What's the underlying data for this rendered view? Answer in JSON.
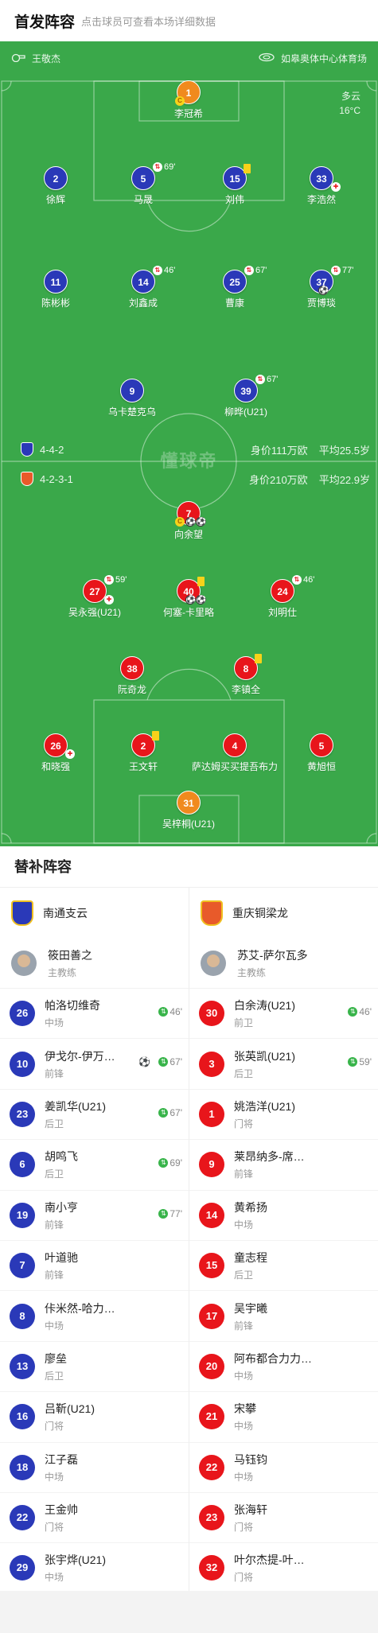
{
  "header": {
    "title": "首发阵容",
    "subtitle": "点击球员可查看本场详细数据"
  },
  "pitch": {
    "referee": "王敬杰",
    "stadium": "如皋奥体中心体育场",
    "weather": "多云",
    "temperature": "16°C",
    "watermark": "懂球帝",
    "home": {
      "formation": "4-4-2",
      "value": "身价111万欧",
      "avg_age": "平均25.5岁",
      "color": "#2a39b8"
    },
    "away": {
      "formation": "4-2-3-1",
      "value": "身价210万欧",
      "avg_age": "平均22.9岁",
      "color": "#e8151b"
    },
    "home_players": [
      {
        "num": "1",
        "name": "李冠希",
        "gk": true,
        "captain": true
      },
      {
        "num": "2",
        "name": "徐辉"
      },
      {
        "num": "5",
        "name": "马晟",
        "sub": "69'"
      },
      {
        "num": "15",
        "name": "刘伟",
        "yellow": true
      },
      {
        "num": "33",
        "name": "李浩然",
        "kick": true
      },
      {
        "num": "11",
        "name": "陈彬彬"
      },
      {
        "num": "14",
        "name": "刘鑫成",
        "sub": "46'"
      },
      {
        "num": "25",
        "name": "曹康",
        "sub": "67'"
      },
      {
        "num": "37",
        "name": "贾博琰",
        "sub": "77'",
        "goal": true
      },
      {
        "num": "9",
        "name": "乌卡楚克乌"
      },
      {
        "num": "39",
        "name": "柳晔(U21)",
        "sub": "67'"
      }
    ],
    "away_players": [
      {
        "num": "7",
        "name": "向余望",
        "captain": true,
        "goals": 2
      },
      {
        "num": "27",
        "name": "吴永强(U21)",
        "sub": "59'",
        "kick": true
      },
      {
        "num": "40",
        "name": "何塞-卡里略",
        "yellow": true,
        "goals": 2
      },
      {
        "num": "24",
        "name": "刘明仕",
        "sub": "46'"
      },
      {
        "num": "38",
        "name": "阮奇龙"
      },
      {
        "num": "8",
        "name": "李镇全",
        "yellow": true
      },
      {
        "num": "26",
        "name": "和晓强",
        "kick": true
      },
      {
        "num": "2",
        "name": "王文轩",
        "yellow": true
      },
      {
        "num": "4",
        "name": "萨达姆买买提吾布力"
      },
      {
        "num": "5",
        "name": "黄旭恒"
      },
      {
        "num": "31",
        "name": "吴梓桐(U21)",
        "gk": true
      }
    ]
  },
  "subs": {
    "title": "替补阵容",
    "home": {
      "team": "南通支云",
      "coach": "筱田善之",
      "coach_role": "主教练",
      "players": [
        {
          "num": "26",
          "name": "帕洛切维奇",
          "pos": "中场",
          "sub": "46'"
        },
        {
          "num": "10",
          "name": "伊戈尔-伊万…",
          "pos": "前锋",
          "sub": "67'",
          "goal": true
        },
        {
          "num": "23",
          "name": "姜凯华(U21)",
          "pos": "后卫",
          "sub": "67'"
        },
        {
          "num": "6",
          "name": "胡鸣飞",
          "pos": "后卫",
          "sub": "69'"
        },
        {
          "num": "19",
          "name": "南小亨",
          "pos": "前锋",
          "sub": "77'"
        },
        {
          "num": "7",
          "name": "叶道驰",
          "pos": "前锋"
        },
        {
          "num": "8",
          "name": "佧米然-哈力…",
          "pos": "中场"
        },
        {
          "num": "13",
          "name": "廖垒",
          "pos": "后卫"
        },
        {
          "num": "16",
          "name": "吕靳(U21)",
          "pos": "门将"
        },
        {
          "num": "18",
          "name": "江子磊",
          "pos": "中场"
        },
        {
          "num": "22",
          "name": "王金帅",
          "pos": "门将"
        },
        {
          "num": "29",
          "name": "张宇烨(U21)",
          "pos": "中场"
        }
      ]
    },
    "away": {
      "team": "重庆铜梁龙",
      "coach": "苏艾-萨尔瓦多",
      "coach_role": "主教练",
      "players": [
        {
          "num": "30",
          "name": "白余涛(U21)",
          "pos": "前卫",
          "sub": "46'"
        },
        {
          "num": "3",
          "name": "张英凯(U21)",
          "pos": "后卫",
          "sub": "59'"
        },
        {
          "num": "1",
          "name": "姚浩洋(U21)",
          "pos": "门将"
        },
        {
          "num": "9",
          "name": "莱昂纳多-席…",
          "pos": "前锋"
        },
        {
          "num": "14",
          "name": "黄希扬",
          "pos": "中场"
        },
        {
          "num": "15",
          "name": "童志程",
          "pos": "后卫"
        },
        {
          "num": "17",
          "name": "吴宇曦",
          "pos": "前锋"
        },
        {
          "num": "20",
          "name": "阿布都合力力…",
          "pos": "中场"
        },
        {
          "num": "21",
          "name": "宋攀",
          "pos": "中场"
        },
        {
          "num": "22",
          "name": "马钰钧",
          "pos": "中场"
        },
        {
          "num": "23",
          "name": "张海轩",
          "pos": "门将"
        },
        {
          "num": "32",
          "name": "叶尔杰提-叶…",
          "pos": "门将"
        }
      ]
    }
  }
}
